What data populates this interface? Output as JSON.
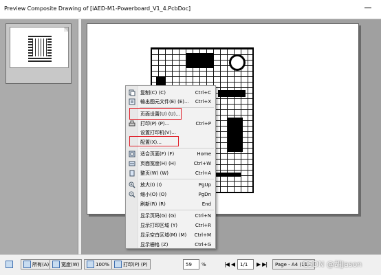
{
  "window": {
    "title": "Preview Composite Drawing of [iAED-M1-Powerboard_V1_4.PcbDoc]"
  },
  "context_menu": {
    "items": [
      {
        "label": "复制(C) (C)",
        "shortcut": "Ctrl+C",
        "icon": "copy-icon"
      },
      {
        "label": "输出图元文件(E) (E)...",
        "shortcut": "Ctrl+X",
        "icon": "export-icon"
      },
      {
        "label": "页面设置(U) (U)...",
        "shortcut": "",
        "icon": ""
      },
      {
        "label": "打印(P) (P)...",
        "shortcut": "Ctrl+P",
        "icon": "print-icon"
      },
      {
        "label": "设置打印机(V)...",
        "shortcut": "",
        "icon": ""
      },
      {
        "label": "配置(X)...",
        "shortcut": "",
        "icon": ""
      },
      {
        "label": "适合页面(F) (F)",
        "shortcut": "Home",
        "icon": "fit-page-icon"
      },
      {
        "label": "页面宽度(H) (H)",
        "shortcut": "Ctrl+W",
        "icon": "page-width-icon"
      },
      {
        "label": "整页(W) (W)",
        "shortcut": "Ctrl+A",
        "icon": "whole-page-icon"
      },
      {
        "label": "放大(I) (I)",
        "shortcut": "PgUp",
        "icon": "zoom-in-icon"
      },
      {
        "label": "缩小(O) (O)",
        "shortcut": "PgDn",
        "icon": "zoom-out-icon"
      },
      {
        "label": "刷新(R) (R)",
        "shortcut": "End",
        "icon": ""
      },
      {
        "label": "显示页码(G) (G)",
        "shortcut": "Ctrl+N",
        "icon": ""
      },
      {
        "label": "显示打印区域 (Y)",
        "shortcut": "Ctrl+R",
        "icon": ""
      },
      {
        "label": "显示空白区域(M) (M)",
        "shortcut": "Ctrl+M",
        "icon": ""
      },
      {
        "label": "显示栅格 (Z)",
        "shortcut": "Ctrl+G",
        "icon": ""
      }
    ]
  },
  "statusbar": {
    "all_label": "所有(A) (A)",
    "width_label": "宽度(W)",
    "zoom100_label": "100%",
    "print_label": "打印(P) (P)",
    "zoom_value": "59",
    "zoom_unit": "%",
    "page_current": "1/1",
    "page_info": "Page - A4 (11...",
    "nav_first": "|◀",
    "nav_prev": "◀",
    "nav_next": "▶",
    "nav_last": "▶|"
  },
  "watermark": "CSDN @胡Jason"
}
